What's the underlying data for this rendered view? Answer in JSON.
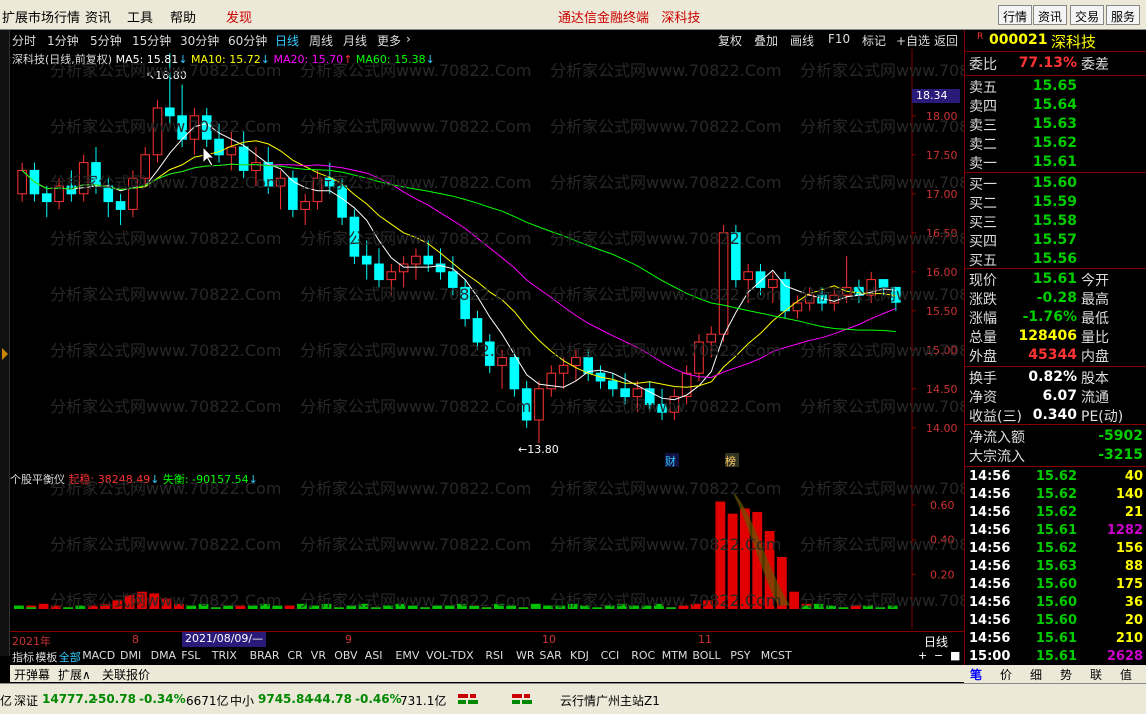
{
  "topbar": {
    "menu": [
      "扩展市场行情",
      "资讯",
      "工具",
      "帮助"
    ],
    "discover": "发现",
    "center_title": "通达信金融终端",
    "center_stock": "深科技",
    "right_buttons": [
      "行情",
      "资讯",
      "交易",
      "服务"
    ]
  },
  "period_tabs": [
    "分时",
    "1分钟",
    "5分钟",
    "15分钟",
    "30分钟",
    "60分钟",
    "日线",
    "周线",
    "月线",
    "更多"
  ],
  "active_period": "日线",
  "chart_tools": [
    "复权",
    "叠加",
    "画线",
    "F10",
    "标记",
    "+自选",
    "返回"
  ],
  "watermark": "分析家公式网www.70822.Com",
  "legend": {
    "name": "深科技(日线,前复权)",
    "ma5": "MA5: 15.81",
    "ma10": "MA10: 15.72",
    "ma20": "MA20: 15.70",
    "ma60": "MA60: 15.38",
    "high_label": "18.80",
    "low_label": "13.80",
    "price_tag": "18.34",
    "marker_cai": "财",
    "marker_bang": "榜"
  },
  "indicator": {
    "name": "个股平衡仪",
    "qiwen_label": "起稳: 38248.49",
    "shiheng_label": "失衡: -90157.54"
  },
  "dates": [
    "2021年",
    "8",
    "2021/08/09/—",
    "9",
    "10",
    "11"
  ],
  "period_label": "日线",
  "indicator_tabs": [
    "指标",
    "模板",
    "全部",
    "MACD",
    "DMI",
    "DMA",
    "FSL",
    "TRIX",
    "BRAR",
    "CR",
    "VR",
    "OBV",
    "ASI",
    "EMV",
    "VOL-TDX",
    "RSI",
    "WR",
    "SAR",
    "KDJ",
    "CCI",
    "ROC",
    "MTM",
    "BOLL",
    "PSY",
    "MCST"
  ],
  "bottom_tabs": [
    "开弹幕",
    "扩展∧",
    "关联报价"
  ],
  "stock": {
    "code": "000021",
    "name": "深科技"
  },
  "quote": {
    "weibi_label": "委比",
    "weibi": "77.13%",
    "weicha_label": "委差",
    "sells": [
      {
        "label": "卖五",
        "price": "15.65"
      },
      {
        "label": "卖四",
        "price": "15.64"
      },
      {
        "label": "卖三",
        "price": "15.63"
      },
      {
        "label": "卖二",
        "price": "15.62"
      },
      {
        "label": "卖一",
        "price": "15.61"
      }
    ],
    "buys": [
      {
        "label": "买一",
        "price": "15.60"
      },
      {
        "label": "买二",
        "price": "15.59"
      },
      {
        "label": "买三",
        "price": "15.58"
      },
      {
        "label": "买四",
        "price": "15.57"
      },
      {
        "label": "买五",
        "price": "15.56"
      }
    ],
    "stats": [
      {
        "label": "现价",
        "value": "15.61",
        "label2": "今开",
        "color": "#0c0"
      },
      {
        "label": "涨跌",
        "value": "-0.28",
        "label2": "最高",
        "color": "#0c0"
      },
      {
        "label": "涨幅",
        "value": "-1.76%",
        "label2": "最低",
        "color": "#0c0"
      },
      {
        "label": "总量",
        "value": "128406",
        "label2": "量比",
        "color": "#ff0"
      },
      {
        "label": "外盘",
        "value": "45344",
        "label2": "内盘",
        "color": "#f33"
      }
    ],
    "stats2": [
      {
        "label": "换手",
        "value": "0.82%",
        "label2": "股本",
        "color": "#fff"
      },
      {
        "label": "净资",
        "value": "6.07",
        "label2": "流通",
        "color": "#fff"
      },
      {
        "label": "收益(三)",
        "value": "0.340",
        "label2": "PE(动)",
        "color": "#fff"
      }
    ],
    "flows": [
      {
        "label": "净流入额",
        "value": "-5902"
      },
      {
        "label": "大宗流入",
        "value": "-3215"
      }
    ]
  },
  "ticks": [
    {
      "t": "14:56",
      "p": "15.62",
      "v": "40",
      "vc": "#ff0"
    },
    {
      "t": "14:56",
      "p": "15.62",
      "v": "140",
      "vc": "#ff0"
    },
    {
      "t": "14:56",
      "p": "15.62",
      "v": "21",
      "vc": "#ff0"
    },
    {
      "t": "14:56",
      "p": "15.61",
      "v": "1282",
      "vc": "#c0c"
    },
    {
      "t": "14:56",
      "p": "15.62",
      "v": "156",
      "vc": "#ff0"
    },
    {
      "t": "14:56",
      "p": "15.63",
      "v": "88",
      "vc": "#ff0"
    },
    {
      "t": "14:56",
      "p": "15.60",
      "v": "175",
      "vc": "#ff0"
    },
    {
      "t": "14:56",
      "p": "15.60",
      "v": "36",
      "vc": "#ff0"
    },
    {
      "t": "14:56",
      "p": "15.60",
      "v": "20",
      "vc": "#ff0"
    },
    {
      "t": "14:56",
      "p": "15.61",
      "v": "210",
      "vc": "#ff0"
    },
    {
      "t": "15:00",
      "p": "15.61",
      "v": "2628",
      "vc": "#c0c"
    }
  ],
  "right_tabs": [
    "笔",
    "价",
    "细",
    "势",
    "联",
    "值"
  ],
  "status": {
    "sz_label": "深证",
    "sz_val": "14777.2",
    "sz_chg": "-50.78",
    "sz_pct": "-0.34%",
    "sz_amt": "6671亿",
    "zx_label": "中小",
    "zx_val": "9745.84",
    "zx_chg": "-44.78",
    "zx_pct": "-0.46%",
    "zx_amt": "731.1亿",
    "server": "云行情广州主站Z1",
    "left_cut": "亿"
  },
  "chart_data": [
    {
      "type": "candlestick",
      "title": "深科技(日线,前复权)",
      "ylim": [
        13.6,
        18.6
      ],
      "yticks": [
        14.0,
        14.5,
        15.0,
        15.5,
        16.0,
        16.5,
        17.0,
        17.5,
        18.0
      ],
      "candles": [
        [
          17.0,
          17.4,
          16.9,
          17.3
        ],
        [
          17.3,
          17.4,
          16.9,
          17.0
        ],
        [
          17.0,
          17.1,
          16.7,
          16.9
        ],
        [
          16.9,
          17.2,
          16.8,
          17.1
        ],
        [
          17.1,
          17.3,
          16.9,
          17.0
        ],
        [
          17.0,
          17.5,
          16.9,
          17.4
        ],
        [
          17.4,
          17.6,
          17.0,
          17.1
        ],
        [
          17.1,
          17.2,
          16.7,
          16.9
        ],
        [
          16.9,
          17.0,
          16.6,
          16.8
        ],
        [
          16.8,
          17.3,
          16.7,
          17.2
        ],
        [
          17.2,
          17.6,
          17.1,
          17.5
        ],
        [
          17.5,
          18.2,
          17.4,
          18.1
        ],
        [
          18.1,
          18.8,
          17.9,
          18.0
        ],
        [
          18.0,
          18.4,
          17.6,
          17.7
        ],
        [
          17.7,
          18.1,
          17.5,
          18.0
        ],
        [
          18.0,
          18.1,
          17.6,
          17.7
        ],
        [
          17.7,
          17.9,
          17.4,
          17.5
        ],
        [
          17.5,
          17.8,
          17.3,
          17.6
        ],
        [
          17.6,
          17.8,
          17.2,
          17.3
        ],
        [
          17.3,
          17.6,
          17.1,
          17.4
        ],
        [
          17.4,
          17.6,
          17.0,
          17.1
        ],
        [
          17.1,
          17.3,
          16.8,
          17.2
        ],
        [
          17.2,
          17.3,
          16.7,
          16.8
        ],
        [
          16.8,
          17.0,
          16.6,
          16.9
        ],
        [
          16.9,
          17.3,
          16.8,
          17.2
        ],
        [
          17.2,
          17.4,
          17.0,
          17.1
        ],
        [
          17.1,
          17.2,
          16.6,
          16.7
        ],
        [
          16.7,
          16.8,
          16.1,
          16.2
        ],
        [
          16.2,
          16.4,
          15.9,
          16.1
        ],
        [
          16.1,
          16.3,
          15.8,
          15.9
        ],
        [
          15.9,
          16.1,
          15.7,
          16.0
        ],
        [
          16.0,
          16.2,
          15.8,
          16.1
        ],
        [
          16.1,
          16.3,
          15.9,
          16.2
        ],
        [
          16.2,
          16.4,
          16.0,
          16.1
        ],
        [
          16.1,
          16.3,
          15.9,
          16.0
        ],
        [
          16.0,
          16.2,
          15.7,
          15.8
        ],
        [
          15.8,
          15.9,
          15.3,
          15.4
        ],
        [
          15.4,
          15.5,
          15.0,
          15.1
        ],
        [
          15.1,
          15.2,
          14.7,
          14.8
        ],
        [
          14.8,
          15.0,
          14.5,
          14.9
        ],
        [
          14.9,
          15.0,
          14.4,
          14.5
        ],
        [
          14.5,
          14.6,
          14.0,
          14.1
        ],
        [
          14.1,
          14.6,
          13.8,
          14.5
        ],
        [
          14.5,
          14.8,
          14.4,
          14.7
        ],
        [
          14.7,
          14.9,
          14.5,
          14.8
        ],
        [
          14.8,
          15.0,
          14.6,
          14.9
        ],
        [
          14.9,
          15.0,
          14.6,
          14.7
        ],
        [
          14.7,
          14.8,
          14.5,
          14.6
        ],
        [
          14.6,
          14.7,
          14.4,
          14.5
        ],
        [
          14.5,
          14.7,
          14.3,
          14.4
        ],
        [
          14.4,
          14.6,
          14.2,
          14.5
        ],
        [
          14.5,
          14.6,
          14.2,
          14.3
        ],
        [
          14.3,
          14.5,
          14.1,
          14.2
        ],
        [
          14.2,
          14.5,
          14.1,
          14.4
        ],
        [
          14.4,
          14.8,
          14.3,
          14.7
        ],
        [
          14.7,
          15.2,
          14.6,
          15.1
        ],
        [
          15.1,
          15.3,
          14.9,
          15.2
        ],
        [
          15.2,
          16.6,
          15.1,
          16.5
        ],
        [
          16.5,
          16.6,
          15.8,
          15.9
        ],
        [
          15.9,
          16.1,
          15.6,
          16.0
        ],
        [
          16.0,
          16.1,
          15.7,
          15.8
        ],
        [
          15.8,
          16.0,
          15.6,
          15.9
        ],
        [
          15.9,
          16.0,
          15.4,
          15.5
        ],
        [
          15.5,
          15.7,
          15.4,
          15.6
        ],
        [
          15.6,
          15.8,
          15.5,
          15.7
        ],
        [
          15.7,
          15.8,
          15.5,
          15.6
        ],
        [
          15.6,
          15.8,
          15.5,
          15.7
        ],
        [
          15.7,
          16.2,
          15.6,
          15.8
        ],
        [
          15.8,
          15.9,
          15.6,
          15.7
        ],
        [
          15.7,
          16.0,
          15.6,
          15.9
        ],
        [
          15.9,
          15.9,
          15.7,
          15.8
        ],
        [
          15.8,
          15.8,
          15.5,
          15.61
        ]
      ],
      "series": [
        {
          "name": "MA5",
          "color": "#ffffff"
        },
        {
          "name": "MA10",
          "color": "#ffff00"
        },
        {
          "name": "MA20",
          "color": "#ff00ff"
        },
        {
          "name": "MA60",
          "color": "#00ff00"
        }
      ]
    },
    {
      "type": "bar",
      "title": "个股平衡仪",
      "ylim": [
        0,
        0.75
      ],
      "yticks": [
        0.2,
        0.4,
        0.6
      ],
      "series": [
        {
          "name": "起稳",
          "color": "#e00000"
        },
        {
          "name": "失衡",
          "color": "#00c000"
        }
      ]
    }
  ]
}
